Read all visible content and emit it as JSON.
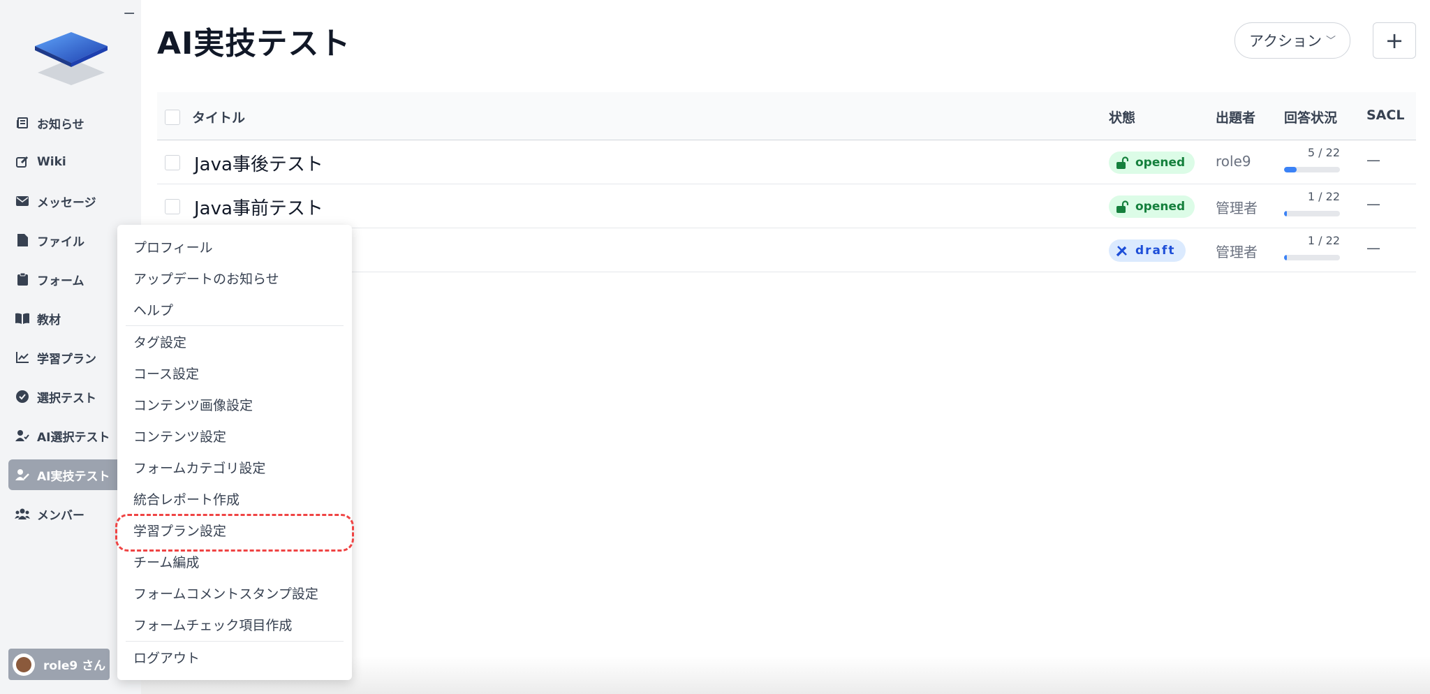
{
  "header": {
    "title": "AI実技テスト",
    "action_label": "アクション",
    "plus_label": "+"
  },
  "sidebar": {
    "collapse_label": "−",
    "items": [
      {
        "label": "お知らせ",
        "icon": "newspaper-icon"
      },
      {
        "label": "Wiki",
        "icon": "edit-icon"
      },
      {
        "label": "メッセージ",
        "icon": "envelope-icon"
      },
      {
        "label": "ファイル",
        "icon": "file-icon"
      },
      {
        "label": "フォーム",
        "icon": "clipboard-icon"
      },
      {
        "label": "教材",
        "icon": "book-icon"
      },
      {
        "label": "学習プラン",
        "icon": "chart-line-icon"
      },
      {
        "label": "選択テスト",
        "icon": "check-circle-icon"
      },
      {
        "label": "AI選択テスト",
        "icon": "user-check-icon"
      },
      {
        "label": "AI実技テスト",
        "icon": "user-pen-icon",
        "active": true
      },
      {
        "label": "メンバー",
        "icon": "users-icon"
      }
    ],
    "user_label": "role9 さん"
  },
  "table": {
    "headers": {
      "title": "タイトル",
      "status": "状態",
      "author": "出題者",
      "progress": "回答状況",
      "sacl": "SACL"
    },
    "rows": [
      {
        "title": "Java事後テスト",
        "status": "opened",
        "author": "role9",
        "progress_text": "5 / 22",
        "progress": 0.227,
        "sacl": "—"
      },
      {
        "title": "Java事前テスト",
        "status": "opened",
        "author": "管理者",
        "progress_text": "1 / 22",
        "progress": 0.045,
        "sacl": "—"
      },
      {
        "title": "",
        "status": "draft",
        "author": "管理者",
        "progress_text": "1 / 22",
        "progress": 0.045,
        "sacl": "—"
      }
    ]
  },
  "menu": {
    "items": [
      "プロフィール",
      "アップデートのお知らせ",
      "ヘルプ",
      "タグ設定",
      "コース設定",
      "コンテンツ画像設定",
      "コンテンツ設定",
      "フォームカテゴリ設定",
      "統合レポート作成",
      "学習プラン設定",
      "チーム編成",
      "フォームコメントスタンプ設定",
      "フォームチェック項目作成",
      "ログアウト"
    ]
  },
  "colors": {
    "accent": "#3b82f6",
    "opened_bg": "#dcfce7",
    "opened_text": "#15803d",
    "draft_bg": "#dbeafe",
    "draft_text": "#1d4ed8",
    "highlight": "#ef4444"
  }
}
